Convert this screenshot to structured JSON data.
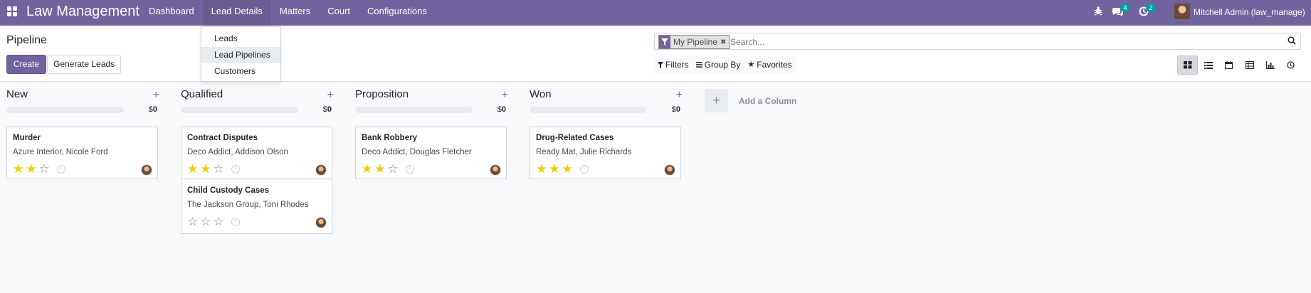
{
  "navbar": {
    "brand": "Law Management",
    "menu": [
      {
        "label": "Dashboard"
      },
      {
        "label": "Lead Details"
      },
      {
        "label": "Matters"
      },
      {
        "label": "Court"
      },
      {
        "label": "Configurations"
      }
    ],
    "messages_count": "4",
    "activities_count": "2",
    "user_name": "Mitchell Admin (law_manage)",
    "color": "#71639e"
  },
  "dropdown": {
    "items": [
      {
        "label": "Leads"
      },
      {
        "label": "Lead Pipelines"
      },
      {
        "label": "Customers"
      }
    ]
  },
  "control": {
    "breadcrumb": "Pipeline",
    "create_label": "Create",
    "generate_label": "Generate Leads",
    "facet_label": "My Pipeline",
    "search_placeholder": "Search...",
    "filters_label": "Filters",
    "groupby_label": "Group By",
    "favorites_label": "Favorites",
    "views": [
      "kanban-icon",
      "list-icon",
      "calendar-icon",
      "pivot-icon",
      "graph-icon",
      "activity-icon"
    ]
  },
  "kanban": {
    "columns": [
      {
        "title": "New",
        "sum_prefix": "$",
        "sum": "0",
        "cards": [
          {
            "title": "Murder",
            "subtitle": "Azure Interior, Nicole Ford",
            "stars": 2
          }
        ]
      },
      {
        "title": "Qualified",
        "sum_prefix": "$",
        "sum": "0",
        "cards": [
          {
            "title": "Contract Disputes",
            "subtitle": "Deco Addict, Addison Olson",
            "stars": 2
          },
          {
            "title": "Child Custody Cases",
            "subtitle": "The Jackson Group, Toni Rhodes",
            "stars": 0
          }
        ]
      },
      {
        "title": "Proposition",
        "sum_prefix": "$",
        "sum": "0",
        "cards": [
          {
            "title": "Bank Robbery",
            "subtitle": "Deco Addict, Douglas Fletcher",
            "stars": 2
          }
        ]
      },
      {
        "title": "Won",
        "sum_prefix": "$",
        "sum": "0",
        "cards": [
          {
            "title": "Drug-Related Cases",
            "subtitle": "Ready Mat, Julie Richards",
            "stars": 3
          }
        ]
      }
    ],
    "add_column_label": "Add a Column"
  }
}
